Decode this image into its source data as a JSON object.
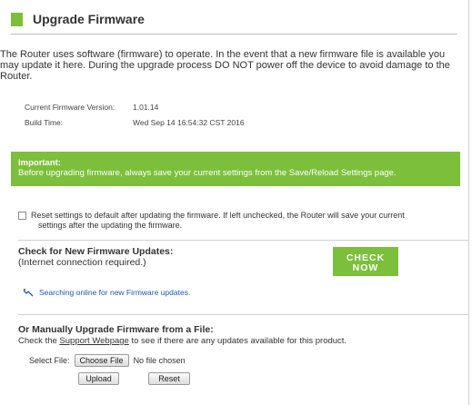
{
  "header": {
    "title": "Upgrade Firmware"
  },
  "intro": "The Router uses software (firmware) to operate. In the event that a new firmware file is available you may update it here. During the upgrade process DO NOT power off the device to avoid damage to the Router.",
  "info": {
    "current_version_label": "Current Firmware Version:",
    "current_version_value": "1.01.14",
    "build_time_label": "Build Time:",
    "build_time_value": "Wed Sep 14 16:54:32 CST 2016"
  },
  "banner": {
    "title": "Important:",
    "text": "Before upgrading firmware, always save your current settings from the Save/Reload Settings page."
  },
  "reset_option": {
    "line1": "Reset settings to default after updating the firmware. If left unchecked, the Router will save your current",
    "line2": "settings after the updating the firmware.",
    "checked": false
  },
  "check_updates": {
    "title": "Check for New Firmware Updates:",
    "subtitle": "(Internet connection required.)",
    "button_line1": "CHECK",
    "button_line2": "NOW",
    "status": "Searching online for new Firmware updates."
  },
  "manual": {
    "title": "Or Manually Upgrade Firmware from a File:",
    "text_before": "Check the ",
    "link": "Support Webpage",
    "text_after": " to see if there are any updates available for this product.",
    "select_file_label": "Select File:",
    "choose_file_button": "Choose File",
    "no_file": "No file chosen",
    "upload_button": "Upload",
    "reset_button": "Reset"
  },
  "colors": {
    "accent": "#7cbf3b",
    "link": "#1f57b8"
  }
}
